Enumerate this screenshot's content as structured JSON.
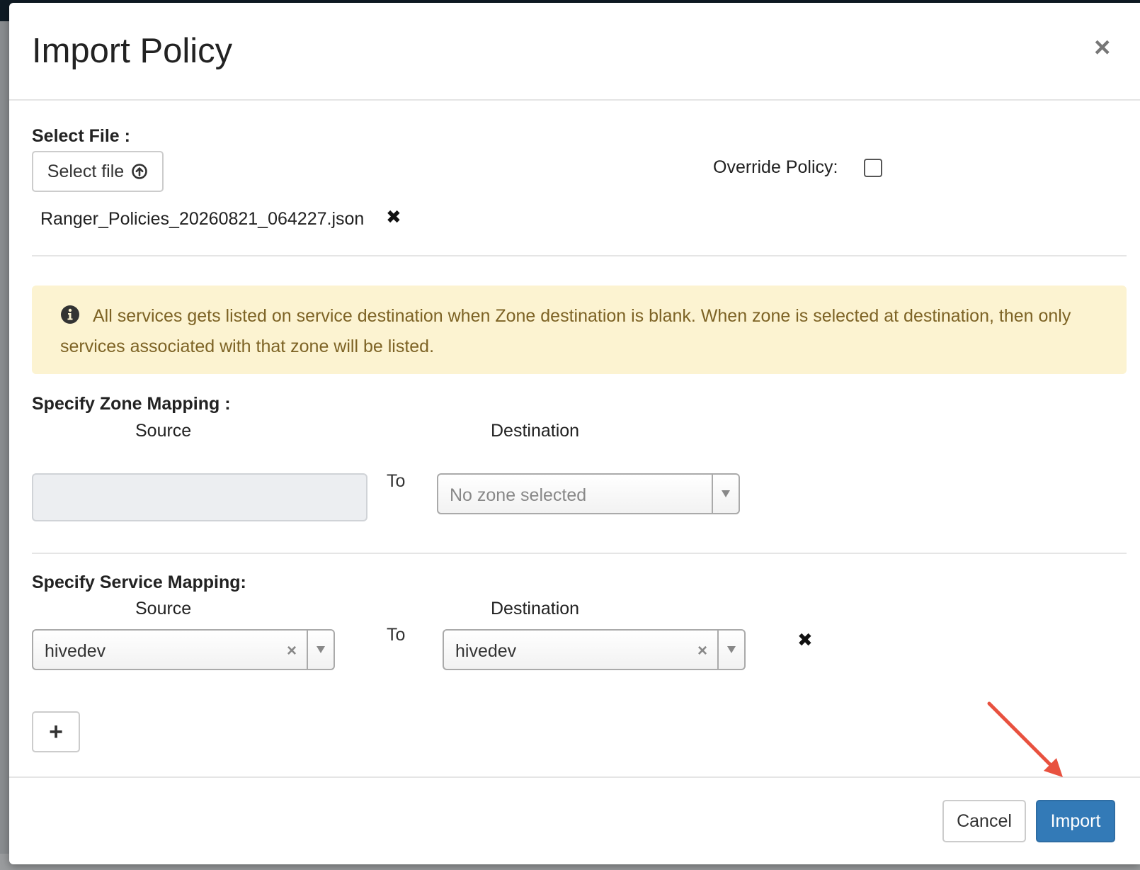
{
  "modal": {
    "title": "Import Policy",
    "close_glyph": "×"
  },
  "file_section": {
    "label": "Select File :",
    "select_button_label": "Select file",
    "upload_icon": "circle-arrow-up-icon",
    "selected_file": "Ranger_Policies_20260821_064227.json",
    "remove_glyph": "✖",
    "override_label": "Override Policy:",
    "override_checked": false
  },
  "alert": {
    "icon": "info-circle-icon",
    "text": "All services gets listed on service destination when Zone destination is blank. When zone is selected at destination, then only services associated with that zone will be listed."
  },
  "zone_mapping": {
    "label": "Specify Zone Mapping :",
    "source_header": "Source",
    "destination_header": "Destination",
    "to_label": "To",
    "source_value": "",
    "destination_placeholder": "No zone selected"
  },
  "service_mapping": {
    "label": "Specify Service Mapping:",
    "source_header": "Source",
    "destination_header": "Destination",
    "to_label": "To",
    "rows": [
      {
        "source": "hivedev",
        "destination": "hivedev"
      }
    ],
    "clear_glyph": "×",
    "remove_row_glyph": "✖",
    "add_glyph": "+"
  },
  "footer": {
    "cancel_label": "Cancel",
    "import_label": "Import"
  },
  "colors": {
    "primary": "#337ab7",
    "alert_bg": "#fcf3d1",
    "alert_text": "#7d6325",
    "annotation_arrow": "#e8513f"
  }
}
